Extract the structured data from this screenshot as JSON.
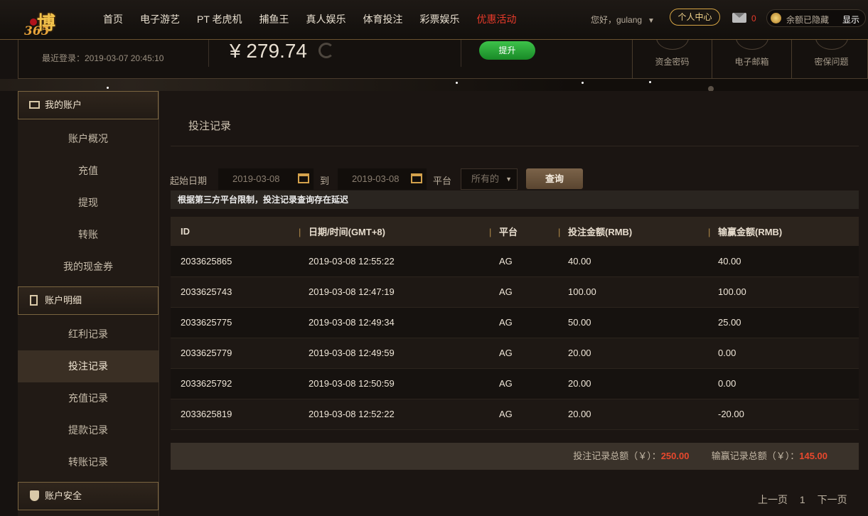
{
  "brand": {
    "logo_text": "博",
    "logo_num": "365"
  },
  "nav": [
    "首页",
    "电子游艺",
    "PT 老虎机",
    "捕鱼王",
    "真人娱乐",
    "体育投注",
    "彩票娱乐",
    "优惠活动"
  ],
  "user": {
    "greeting": "您好，gulang",
    "center_label": "个人中心",
    "mail_count": "0",
    "balance_hidden": "余额已隐藏",
    "show_label": "显示"
  },
  "summary": {
    "last_login": "最近登录：2019-03-07 20:45:10",
    "balance": "¥ 279.74",
    "upgrade_label": "提升",
    "security": [
      "资金密码",
      "电子邮箱",
      "密保问题"
    ]
  },
  "sidebar": {
    "sections": [
      {
        "title": "我的账户",
        "items": [
          "账户概况",
          "充值",
          "提现",
          "转账",
          "我的现金券"
        ]
      },
      {
        "title": "账户明细",
        "items": [
          "红利记录",
          "投注记录",
          "充值记录",
          "提款记录",
          "转账记录"
        ]
      },
      {
        "title": "账户安全",
        "items": []
      }
    ],
    "active": "投注记录"
  },
  "page": {
    "title": "投注记录"
  },
  "filter": {
    "start_label": "起始日期",
    "start_value": "2019-03-08",
    "to_label": "到",
    "end_value": "2019-03-08",
    "platform_label": "平台",
    "platform_value": "所有的",
    "query_label": "查询"
  },
  "notice": "根据第三方平台限制，投注记录查询存在延迟",
  "table": {
    "headers": [
      "ID",
      "日期/时间(GMT+8)",
      "平台",
      "投注金额(RMB)",
      "输赢金额(RMB)"
    ],
    "rows": [
      [
        "2033625865",
        "2019-03-08 12:55:22",
        "AG",
        "40.00",
        "40.00"
      ],
      [
        "2033625743",
        "2019-03-08 12:47:19",
        "AG",
        "100.00",
        "100.00"
      ],
      [
        "2033625775",
        "2019-03-08 12:49:34",
        "AG",
        "50.00",
        "25.00"
      ],
      [
        "2033625779",
        "2019-03-08 12:49:59",
        "AG",
        "20.00",
        "0.00"
      ],
      [
        "2033625792",
        "2019-03-08 12:50:59",
        "AG",
        "20.00",
        "0.00"
      ],
      [
        "2033625819",
        "2019-03-08 12:52:22",
        "AG",
        "20.00",
        "-20.00"
      ]
    ]
  },
  "totals": {
    "bet_label": "投注记录总额（￥）：",
    "bet_value": "250.00",
    "win_label": "输赢记录总额（￥）：",
    "win_value": "145.00"
  },
  "pager": {
    "prev": "上一页",
    "page": "1",
    "next": "下一页"
  },
  "colors": {
    "accent": "#d6a545",
    "promo": "#e83a2a",
    "upgrade": "#2fae3b"
  }
}
